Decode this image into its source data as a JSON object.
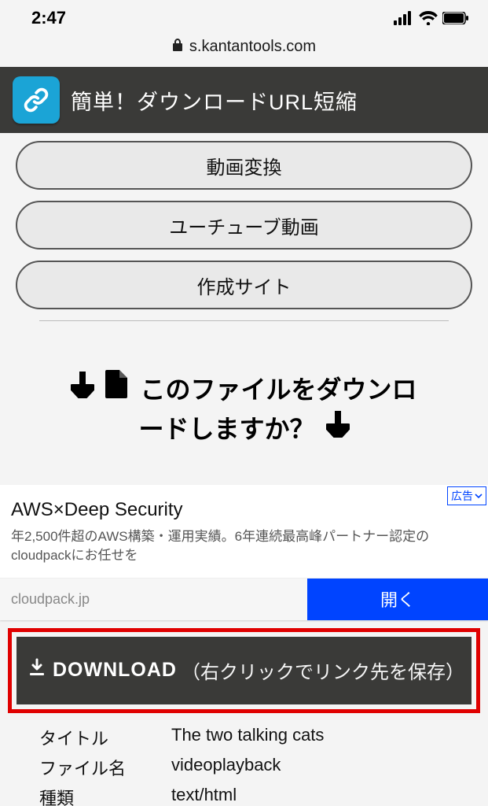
{
  "status_bar": {
    "time": "2:47"
  },
  "browser": {
    "host": "s.kantantools.com"
  },
  "header": {
    "title": "簡単！ダウンロードURL短縮"
  },
  "nav": {
    "items": [
      "動画変換",
      "ユーチューブ動画",
      "作成サイト"
    ]
  },
  "prompt": {
    "line1": "このファイルをダウンロ",
    "line2": "ードしますか？"
  },
  "ad": {
    "badge": "広告",
    "title": "AWS×Deep Security",
    "body": "年2,500件超のAWS構築・運用実績。6年連続最高峰パートナー認定のcloudpackにお任せを",
    "domain": "cloudpack.jp",
    "cta": "開く"
  },
  "download": {
    "label": "DOWNLOAD",
    "hint": "（右クリックでリンク先を保存）"
  },
  "meta": {
    "rows": [
      {
        "k": "タイトル",
        "v": "The two talking cats"
      },
      {
        "k": "ファイル名",
        "v": "videoplayback"
      },
      {
        "k": "種類",
        "v": "text/html"
      }
    ]
  }
}
